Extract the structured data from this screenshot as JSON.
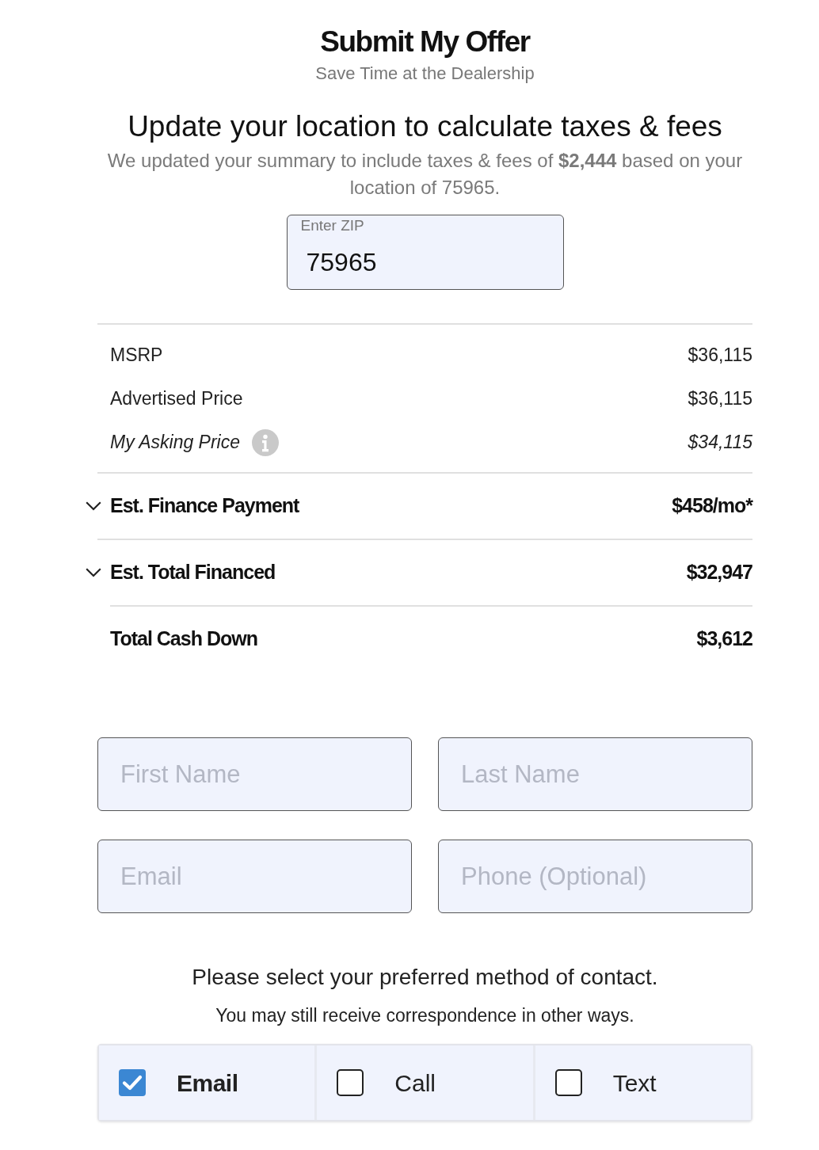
{
  "header": {
    "title": "Submit My Offer",
    "subtitle": "Save Time at the Dealership"
  },
  "location": {
    "heading": "Update your location to calculate taxes & fees",
    "message": "We updated your summary to include taxes & fees of **$2,444** based on your location of 75965.",
    "zip_field": {
      "label": "Enter ZIP",
      "value": "75965"
    }
  },
  "price_lines": [
    {
      "kind": "plain",
      "label": "MSRP",
      "value": "$36,115"
    },
    {
      "kind": "plain",
      "label": "Advertised Price",
      "value": "$36,115"
    },
    {
      "kind": "asking",
      "label": "My Asking Price",
      "value": "$34,115"
    }
  ],
  "summary_rows": [
    {
      "kind": "expandable",
      "label": "Est. Finance Payment",
      "value": "$458/mo*"
    },
    {
      "kind": "expandable",
      "label": "Est. Total Financed",
      "value": "$32,947"
    },
    {
      "kind": "static",
      "label": "Total Cash Down",
      "value": "$3,612"
    }
  ],
  "contact_fields": [
    {
      "placeholder": "First Name"
    },
    {
      "placeholder": "Last Name"
    },
    {
      "placeholder": "Email"
    },
    {
      "placeholder": "Phone (Optional)"
    }
  ],
  "contact_prompt": {
    "question": "Please select your preferred method of contact.",
    "note": "You may still receive correspondence in other ways."
  },
  "contact_methods": [
    {
      "label": "Email",
      "checked": true
    },
    {
      "label": "Call",
      "checked": false
    },
    {
      "label": "Text",
      "checked": false
    }
  ]
}
